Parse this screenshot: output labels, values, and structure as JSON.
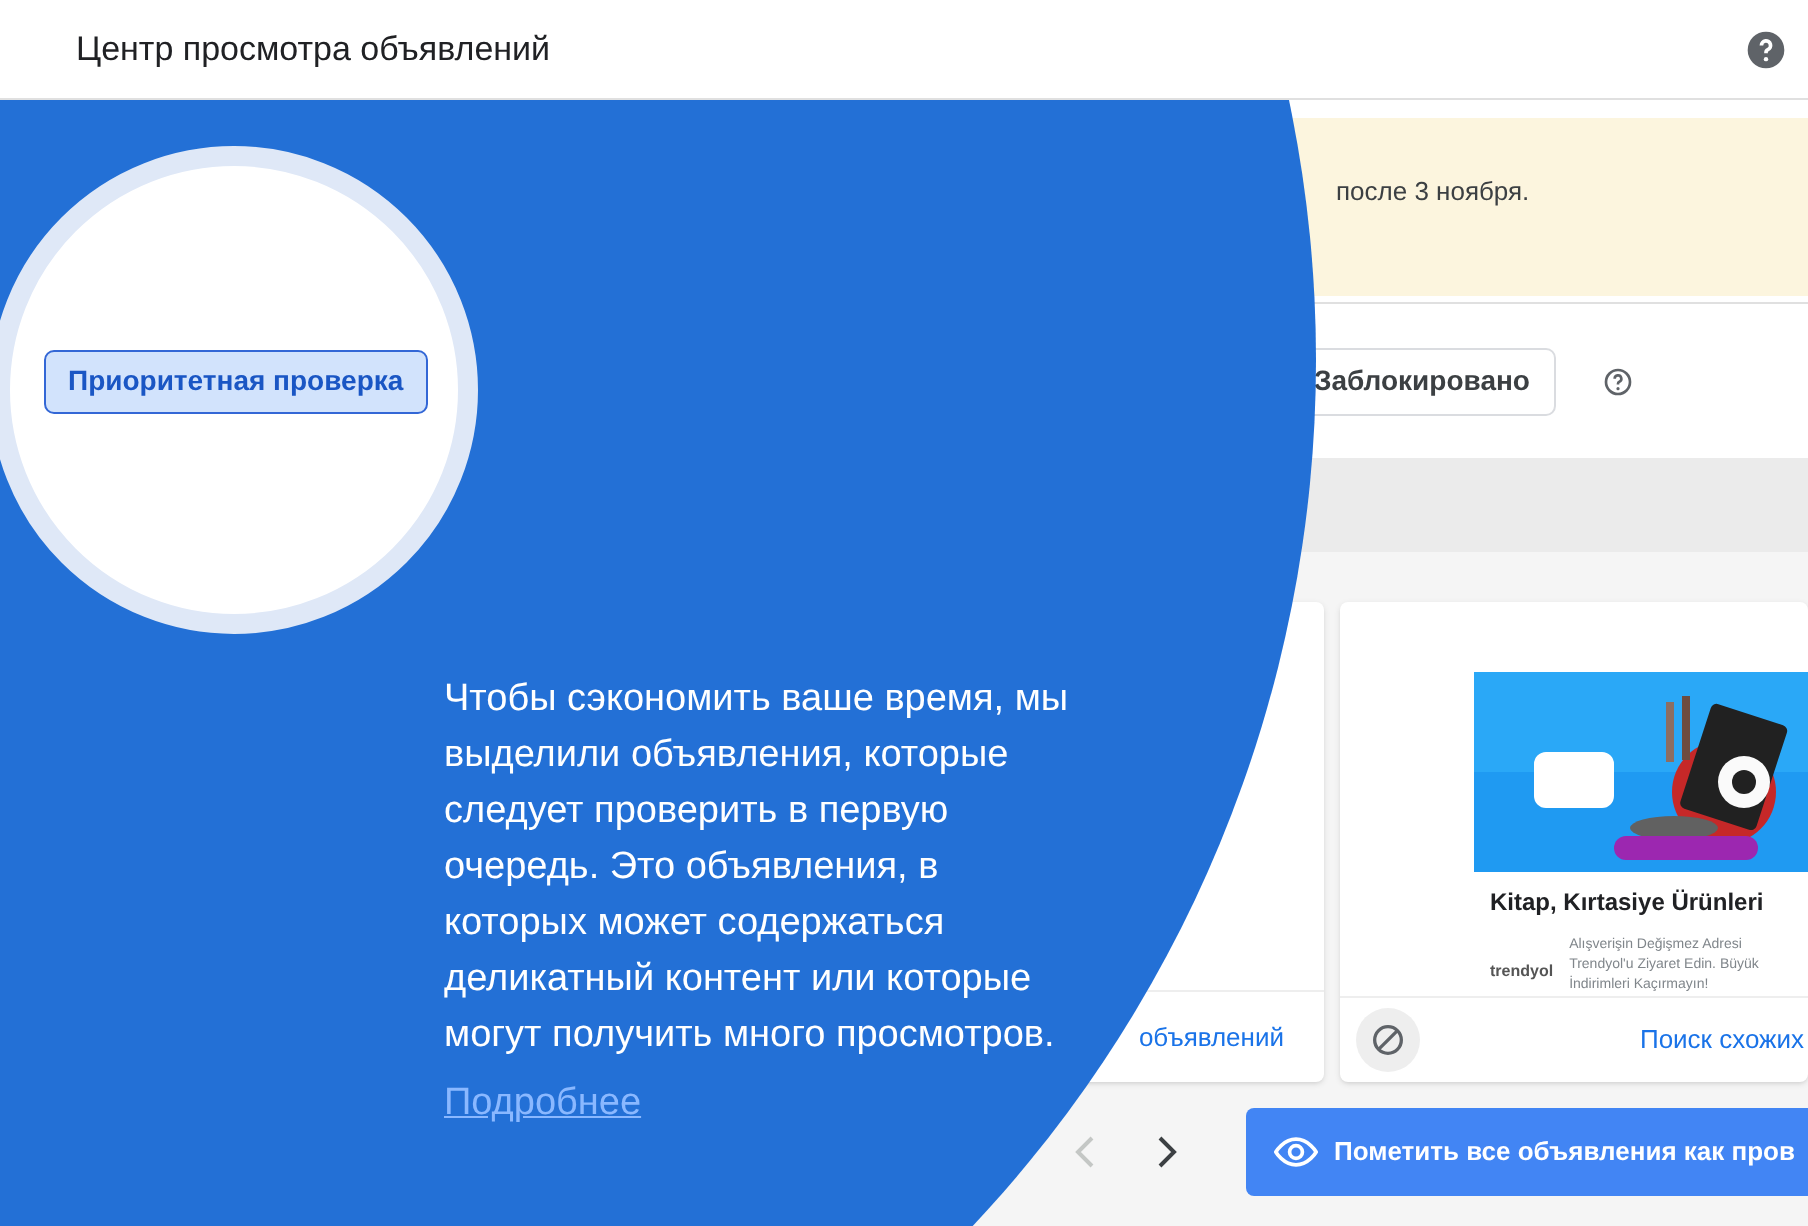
{
  "header": {
    "title": "Центр просмотра объявлений"
  },
  "notice": {
    "text": "после 3 ноября."
  },
  "filters": {
    "tabs": [
      {
        "label": "Приоритетная проверка",
        "selected": true
      }
    ],
    "blocked_button": "Заблокировано"
  },
  "cards": [
    {
      "similar_link": "объявлений"
    },
    {
      "title": "Kitap, Kırtasiye Ürünleri",
      "advertiser": "trendyol",
      "description": "Alışverişin Değişmez Adresi Trendyol'u Ziyaret Edin. Büyük İndirimleri Kaçırmayın!",
      "similar_link": "Поиск схожих"
    }
  ],
  "pagination": {
    "prev_disabled": true,
    "next_disabled": false
  },
  "action_button": "Пометить все объявления как пров",
  "tour": {
    "message": "Чтобы сэкономить ваше время, мы выделили объявления, которые следует проверить в первую очередь. Это объявления, в которых может содержаться деликатный контент или которые могут получить много просмотров.",
    "link": "Подробнее"
  }
}
